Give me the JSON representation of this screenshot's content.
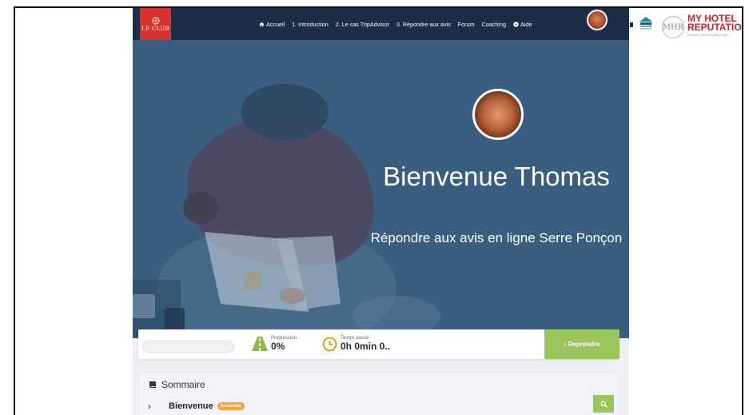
{
  "app": {
    "logo_text": "LE CLUB"
  },
  "nav": {
    "items": [
      {
        "label": "Accueil",
        "icon": "home-icon"
      },
      {
        "label": "1. Introduction"
      },
      {
        "label": "2. Le cas TripAdvisor"
      },
      {
        "label": "3. Répondre aux avis"
      },
      {
        "label": "Forum"
      },
      {
        "label": "Coaching"
      },
      {
        "label": "Aide",
        "icon": "question-circle-icon"
      }
    ],
    "avatar": "user-avatar"
  },
  "hero": {
    "title": "Bienvenue Thomas",
    "subtitle": "Répondre aux avis en ligne Serre Ponçon"
  },
  "progress": {
    "value": 0,
    "progression_label": "Progression",
    "progression_value": "0%",
    "time_label": "Temps passé",
    "time_value": "0h 0min 0..",
    "resume_label": "› Reprendre"
  },
  "sommaire": {
    "title": "Sommaire",
    "first_item": {
      "label": "Bienvenue",
      "badge": "Accessible"
    }
  },
  "partners": {
    "mhr_initials": "MHR",
    "mhr_title": "MY HOTEL REPUTATION",
    "mhr_tagline": "Prenez l'avis du bon côté !"
  },
  "colors": {
    "nav_bg": "#1d2c47",
    "logo_red": "#d8322f",
    "accent_green": "#9cc45c",
    "badge_orange": "#f3a73b",
    "mhr_red": "#c9252c"
  }
}
